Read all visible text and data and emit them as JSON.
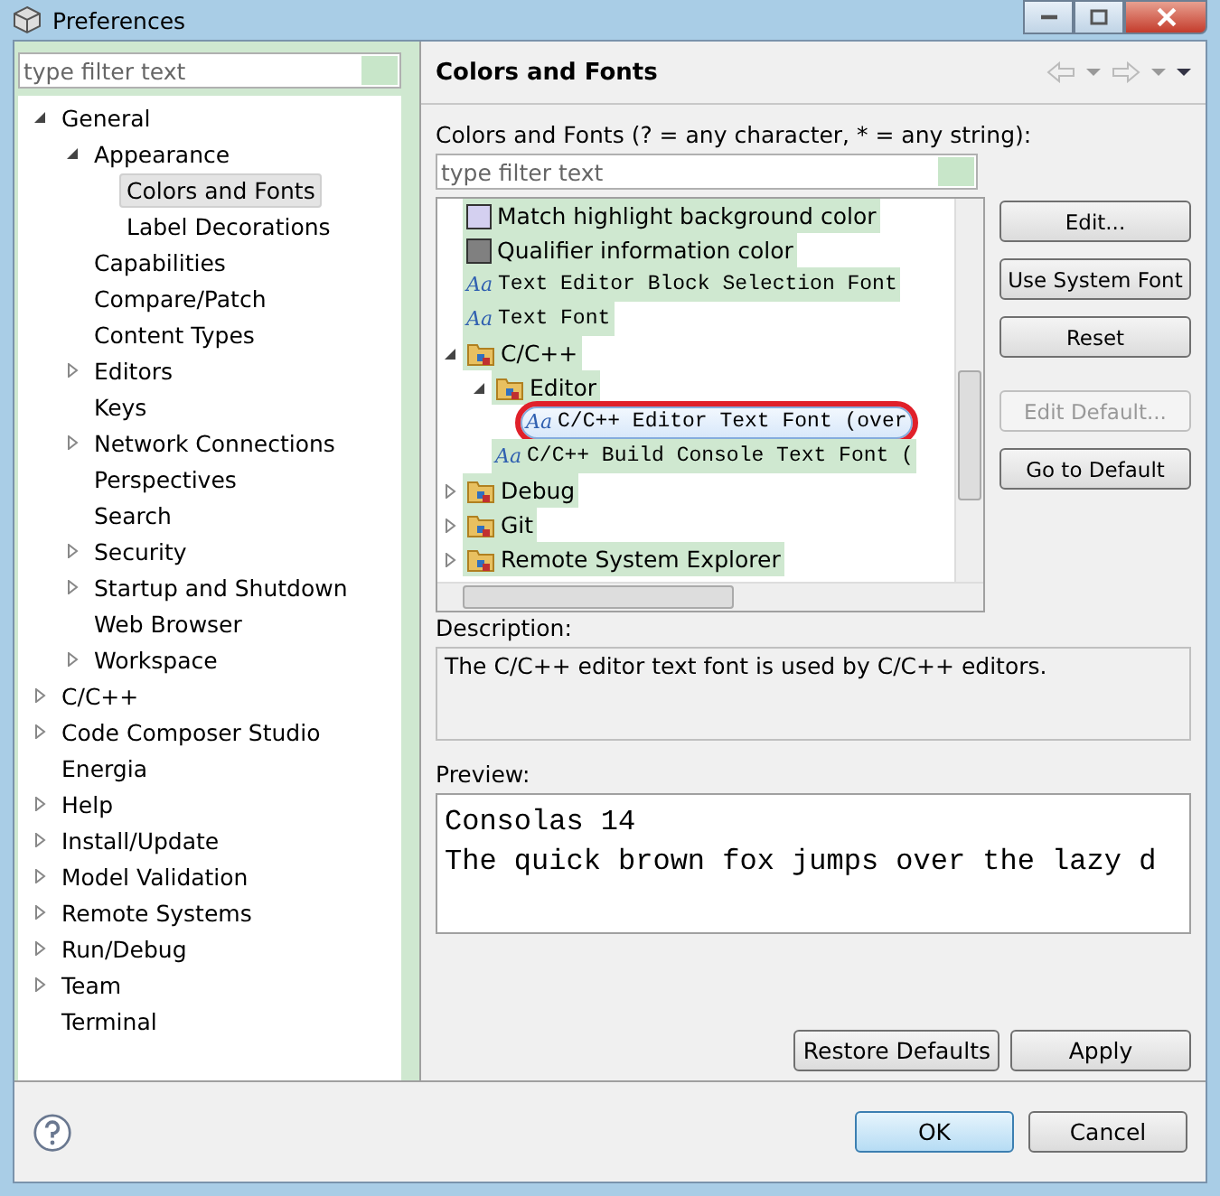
{
  "window": {
    "title": "Preferences"
  },
  "sidebar": {
    "filter": {
      "placeholder": "type filter text"
    },
    "items": [
      {
        "label": "General",
        "expanded": true,
        "selected": false,
        "children": [
          {
            "label": "Appearance",
            "expanded": true,
            "selected": false,
            "children": [
              {
                "label": "Colors and Fonts",
                "selected": true
              },
              {
                "label": "Label Decorations",
                "selected": false
              }
            ]
          },
          {
            "label": "Capabilities",
            "selected": false
          },
          {
            "label": "Compare/Patch",
            "selected": false
          },
          {
            "label": "Content Types",
            "selected": false
          },
          {
            "label": "Editors",
            "expanded": false,
            "selected": false
          },
          {
            "label": "Keys",
            "selected": false
          },
          {
            "label": "Network Connections",
            "expanded": false,
            "selected": false
          },
          {
            "label": "Perspectives",
            "selected": false
          },
          {
            "label": "Search",
            "selected": false
          },
          {
            "label": "Security",
            "expanded": false,
            "selected": false
          },
          {
            "label": "Startup and Shutdown",
            "expanded": false,
            "selected": false
          },
          {
            "label": "Web Browser",
            "selected": false
          },
          {
            "label": "Workspace",
            "expanded": false,
            "selected": false
          }
        ]
      },
      {
        "label": "C/C++",
        "expanded": false,
        "selected": false
      },
      {
        "label": "Code Composer Studio",
        "expanded": false,
        "selected": false
      },
      {
        "label": "Energia",
        "selected": false
      },
      {
        "label": "Help",
        "expanded": false,
        "selected": false
      },
      {
        "label": "Install/Update",
        "expanded": false,
        "selected": false
      },
      {
        "label": "Model Validation",
        "expanded": false,
        "selected": false
      },
      {
        "label": "Remote Systems",
        "expanded": false,
        "selected": false
      },
      {
        "label": "Run/Debug",
        "expanded": false,
        "selected": false
      },
      {
        "label": "Team",
        "expanded": false,
        "selected": false
      },
      {
        "label": "Terminal",
        "selected": false
      }
    ]
  },
  "page": {
    "title": "Colors and Fonts",
    "filter_label": "Colors and Fonts (? = any character, * = any string):",
    "filter": {
      "placeholder": "type filter text"
    },
    "tree": [
      {
        "kind": "color",
        "label": "Match highlight background color",
        "color": "#d4d0f0",
        "selected": false
      },
      {
        "kind": "color",
        "label": "Qualifier information color",
        "color": "#808080",
        "selected": false
      },
      {
        "kind": "font",
        "icon": "Aa",
        "label": "Text Editor Block Selection Font",
        "selected": false
      },
      {
        "kind": "font",
        "icon": "Aa",
        "label": "Text Font",
        "selected": false
      },
      {
        "kind": "category",
        "label": "C/C++",
        "expanded": true,
        "selected": false,
        "children": [
          {
            "kind": "category",
            "label": "Editor",
            "expanded": true,
            "selected": false,
            "children": [
              {
                "kind": "font",
                "icon": "Aa",
                "label": "C/C++ Editor Text Font (over",
                "selected": true
              }
            ]
          },
          {
            "kind": "font",
            "icon": "Aa",
            "label": "C/C++ Build Console Text Font (",
            "selected": false
          }
        ]
      },
      {
        "kind": "category",
        "label": "Debug",
        "expanded": false,
        "selected": false
      },
      {
        "kind": "category",
        "label": "Git",
        "expanded": false,
        "selected": false
      },
      {
        "kind": "category",
        "label": "Remote System Explorer",
        "expanded": false,
        "selected": false
      }
    ],
    "buttons": [
      {
        "label": "Edit...",
        "disabled": false
      },
      {
        "label": "Use System Font",
        "disabled": false
      },
      {
        "label": "Reset",
        "disabled": false
      },
      {
        "label": "Edit Default...",
        "disabled": true
      },
      {
        "label": "Go to Default",
        "disabled": false
      }
    ],
    "description_label": "Description:",
    "description": "The C/C++ editor text font is used by C/C++ editors.",
    "preview_label": "Preview:",
    "preview": [
      "Consolas 14",
      "The quick brown fox jumps over the lazy d"
    ],
    "footer_buttons": [
      "Restore Defaults",
      "Apply"
    ]
  },
  "dialog_buttons": [
    {
      "label": "OK",
      "default": true
    },
    {
      "label": "Cancel",
      "default": false
    }
  ]
}
